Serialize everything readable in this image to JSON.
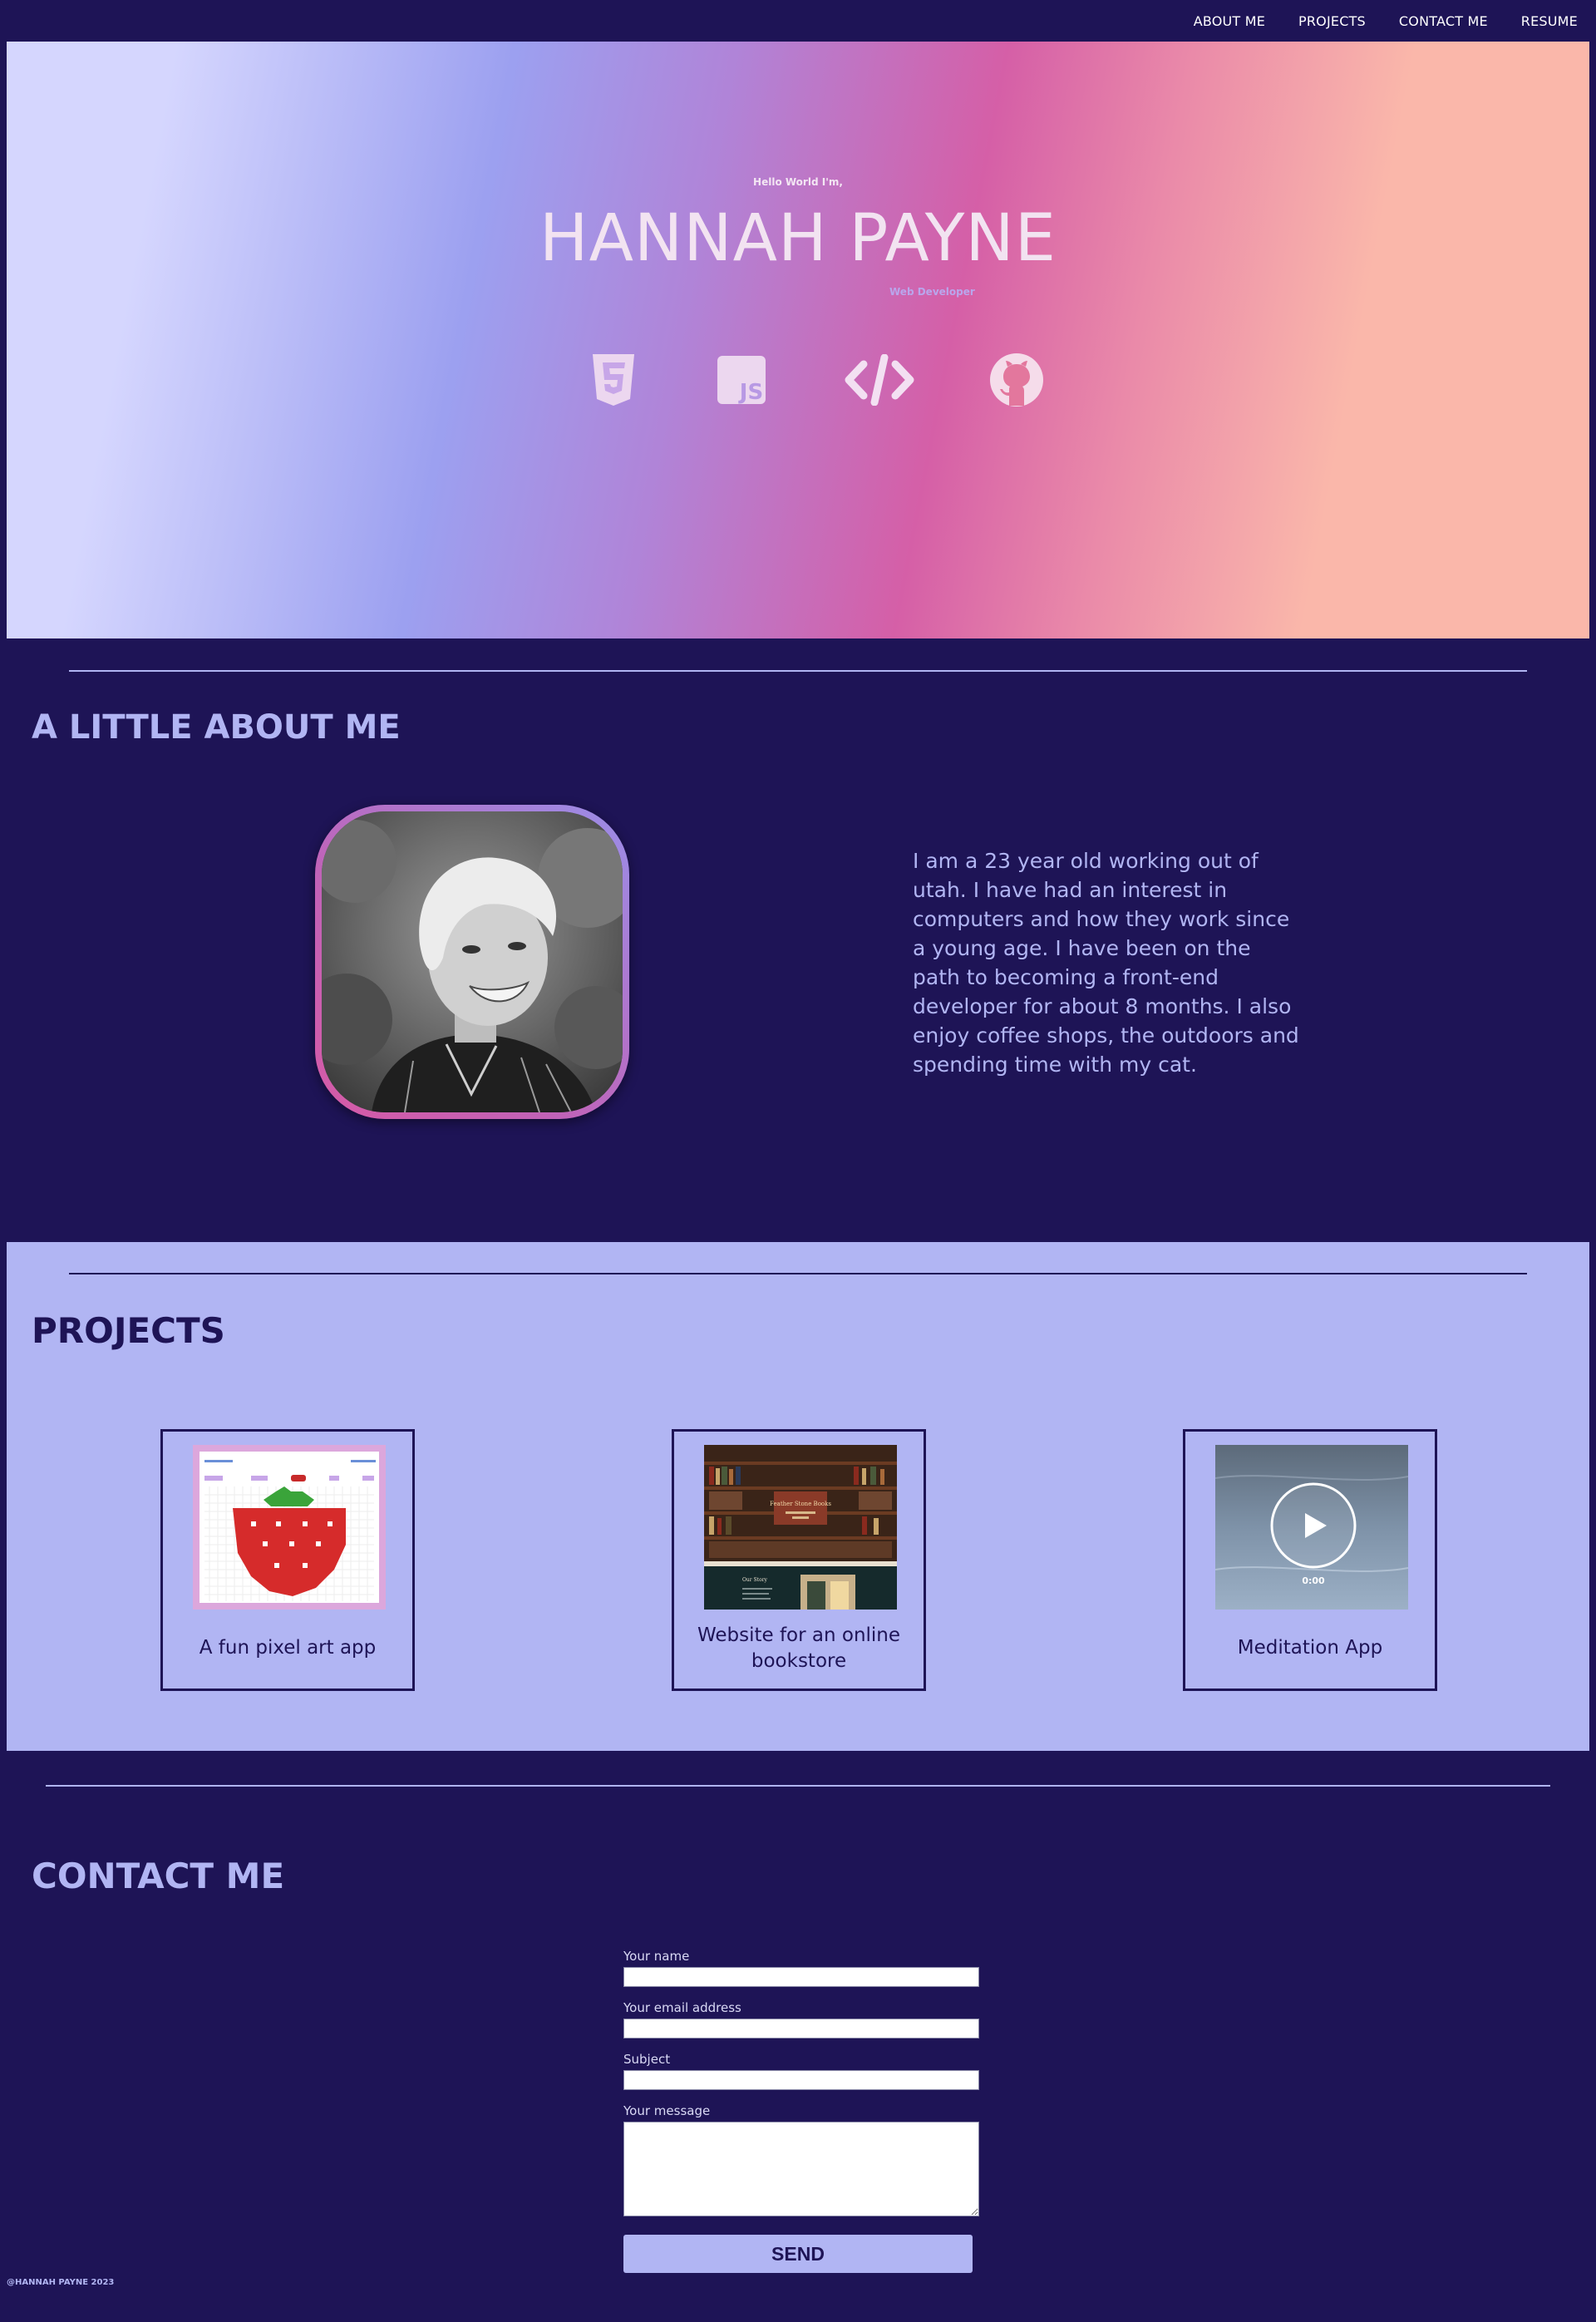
{
  "nav": {
    "items": [
      {
        "label": "ABOUT ME"
      },
      {
        "label": "PROJECTS"
      },
      {
        "label": "CONTACT ME"
      },
      {
        "label": "RESUME"
      }
    ]
  },
  "hero": {
    "greeting": "Hello World I'm,",
    "name": "HANNAH PAYNE",
    "role": "Web Developer",
    "icons": [
      "css3-icon",
      "javascript-icon",
      "code-icon",
      "github-icon"
    ]
  },
  "about": {
    "title": "A LITTLE ABOUT ME",
    "text": "I am a 23 year old working out of utah. I have had an interest in computers and how they work since a young age. I have been on the path to becoming a front-end developer for about 8 months. I also enjoy coffee shops, the outdoors and spending time with my cat."
  },
  "projects": {
    "title": "PROJECTS",
    "items": [
      {
        "label": "A fun pixel art app"
      },
      {
        "label": "Website for an online bookstore",
        "thumb_title": "Feather Stone Books",
        "thumb_subtitle": "Our Story"
      },
      {
        "label": "Meditation App",
        "video_time": "0:00"
      }
    ]
  },
  "contact": {
    "title": "CONTACT ME",
    "fields": {
      "name_label": "Your name",
      "email_label": "Your email address",
      "subject_label": "Subject",
      "message_label": "Your message"
    },
    "send_label": "SEND"
  },
  "footer": {
    "text": "@HANNAH PAYNE 2023"
  },
  "colors": {
    "background": "#1e1456",
    "accent": "#b1b5f3",
    "pink": "#d55fa7",
    "peach": "#fab7aa"
  }
}
